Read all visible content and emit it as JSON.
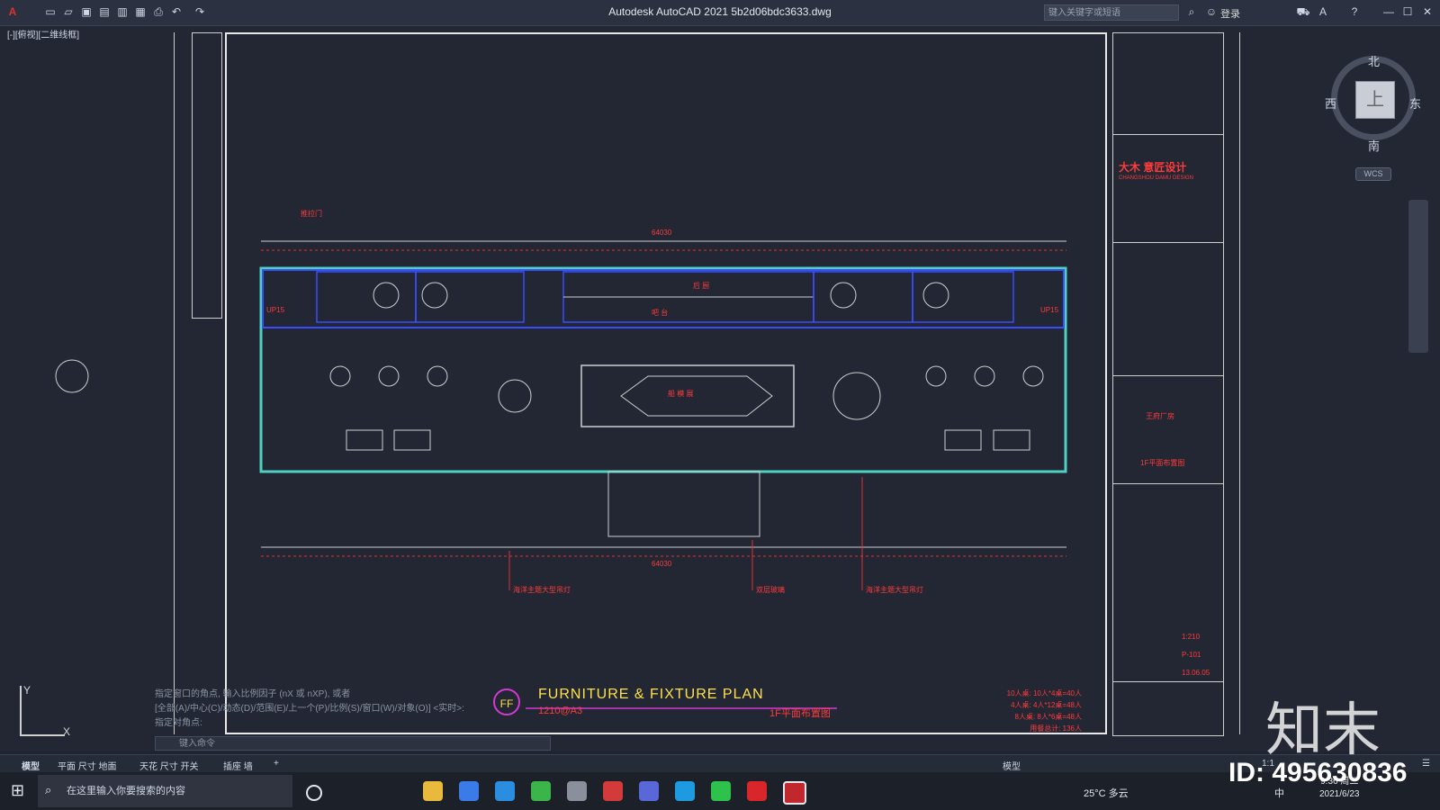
{
  "window": {
    "title": "Autodesk AutoCAD 2021    5b2d06bdc3633.dwg",
    "search_placeholder": "键入关键字或短语",
    "login": "登录"
  },
  "viewport": {
    "label": "[-][俯视][二维线框]"
  },
  "viewcube": {
    "north": "北",
    "south": "南",
    "east": "东",
    "west": "西",
    "face": "上",
    "wcs": "WCS"
  },
  "drawing": {
    "title": "FURNITURE  &  FIXTURE PLAN",
    "badge": "FF",
    "scale": "1210@A3",
    "subtitle_cn": "1F平面布置图",
    "dimension_top": "64030",
    "dimension_bottom": "64030",
    "labels": {
      "kitchen": "后 厨",
      "bar": "吧 台",
      "ship": "船 模 展",
      "lamp1": "海洋主题大型吊灯",
      "lamp2": "双层玻璃",
      "lamp3": "海洋主题大型吊灯",
      "door": "推拉门",
      "up_left": "UP15",
      "up_right": "UP15"
    },
    "seating_notes": [
      "10人桌: 10人*4桌=40人",
      "4人桌: 4人*12桌=48人",
      "8人桌: 8人*6桌=48人",
      "用餐总计: 136人"
    ]
  },
  "titleblock": {
    "company": "大木 意匠设计",
    "company_en": "CHANGSHOU DAMU DESIGN",
    "project_title": "王府厂房",
    "drawing_title": "1F平面布置图",
    "scale": "1:210",
    "drawing_no": "P-101",
    "date": "13.06.05"
  },
  "command": {
    "history": [
      "指定窗口的角点, 输入比例因子 (nX 或 nXP), 或者",
      "[全部(A)/中心(C)/动态(D)/范围(E)/上一个(P)/比例(S)/窗口(W)/对象(O)] <实时>:",
      "指定对角点:"
    ],
    "input_placeholder": "键入命令"
  },
  "tabs": [
    "模型",
    "平面 尺寸 地面",
    "天花 尺寸 开关",
    "插座 墙",
    "+"
  ],
  "status": {
    "model": "模型",
    "scale": "1:1"
  },
  "taskbar": {
    "search": "在这里输入你要搜索的内容",
    "weather": "25°C 多云",
    "time": "9:36 周二",
    "date": "2021/6/23",
    "ime": "中"
  },
  "watermark": {
    "logo": "知末",
    "id": "ID: 495630836"
  }
}
